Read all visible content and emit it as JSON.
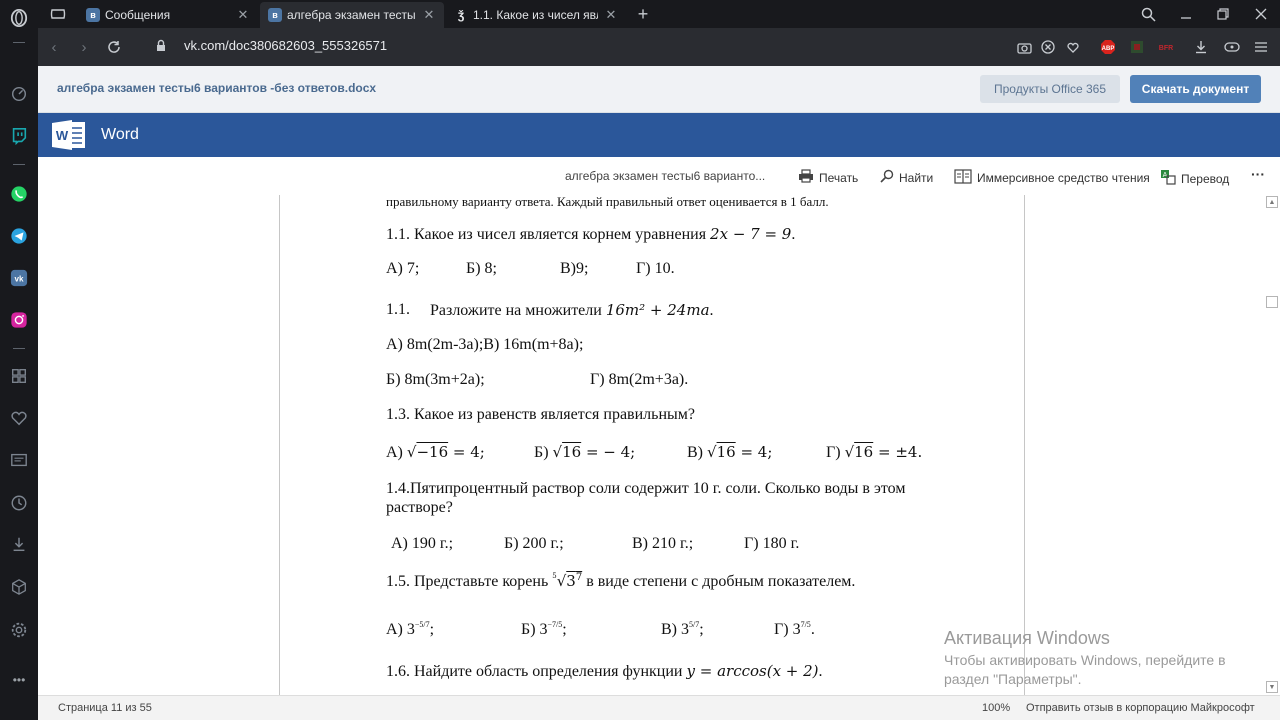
{
  "browser": {
    "tabs": [
      {
        "title": "Сообщения",
        "favicon": "vk-icon",
        "active": false
      },
      {
        "title": "алгебра экзамен тестыб вариантов",
        "favicon": "vk-icon",
        "active": true
      },
      {
        "title": "1.1. Какое из чисел являет",
        "favicon": "yandex-icon",
        "active": false
      }
    ],
    "new_tab_label": "+",
    "url": "vk.com/doc380682603_555326571"
  },
  "vk": {
    "doc_name": "алгебра экзамен тесты6 вариантов -без ответов.docx",
    "office_button": "Продукты Office 365",
    "download_button": "Скачать документ"
  },
  "word": {
    "app_name": "Word",
    "toolbar": {
      "doc_title": "алгебра экзамен тесты6 варианто...",
      "print": "Печать",
      "find": "Найти",
      "immersive": "Иммерсивное средство чтения",
      "translate": "Перевод",
      "more": "···"
    }
  },
  "document": {
    "intro": "правильному варианту ответа. Каждый правильный ответ оценивается в 1 балл.",
    "q1_text": "1.1. Какое из чисел является корнем уравнения ",
    "q1_eq": "2x − 7 = 9",
    "q1_end": ".",
    "q1_answers": [
      "А) 7;",
      "Б) 8;",
      "В)9;",
      "Г) 10."
    ],
    "q2_num": "1.1.",
    "q2_text": "Разложите на множители ",
    "q2_expr": "16m² + 24ma",
    "q2_end": ".",
    "q2_line1": "А) 8m(2m-3a);В) 16m(m+8a);",
    "q2_line2a": "Б) 8m(3m+2a);",
    "q2_line2b": "Г) 8m(2m+3a).",
    "q3_text": "1.3. Какое из равенств является правильным?",
    "q3_answers": [
      {
        "label": "А)",
        "rad": "−16",
        "rest": "= 4;"
      },
      {
        "label": "Б)",
        "rad": "16",
        "rest": "= − 4;"
      },
      {
        "label": "В)",
        "rad": "16",
        "rest": "= 4;"
      },
      {
        "label": "Г)",
        "rad": "16",
        "rest": "= ±4."
      }
    ],
    "q4_text1": "1.4.Пятипроцентный раствор соли содержит 10 г. соли. Сколько воды в этом",
    "q4_text2": "растворе?",
    "q4_answers": [
      "А) 190 г.;",
      "Б) 200 г.;",
      "В) 210 г.;",
      "Г) 180 г."
    ],
    "q5_text_a": "1.5. Представьте корень ",
    "q5_root_index": "5",
    "q5_root_body": "3",
    "q5_root_exp": "7",
    "q5_text_b": " в виде степени  с дробным показателем.",
    "q5_answers": [
      {
        "label": "А) 3",
        "exp": "−5/7",
        "end": ";"
      },
      {
        "label": "Б) 3",
        "exp": "−7/5",
        "end": ";"
      },
      {
        "label": "В) 3",
        "exp": "5/7",
        "end": ";"
      },
      {
        "label": "Г) 3",
        "exp": "7/5",
        "end": "."
      }
    ],
    "q6_text": "1.6. Найдите область определения функции ",
    "q6_expr": "y = arccos(x + 2)",
    "q6_end": "."
  },
  "activation": {
    "title": "Активация Windows",
    "desc": "Чтобы активировать Windows, перейдите в раздел \"Параметры\"."
  },
  "status": {
    "page": "Страница 11 из 55",
    "zoom": "100%",
    "feedback": "Отправить отзыв в корпорацию Майкрософт"
  }
}
